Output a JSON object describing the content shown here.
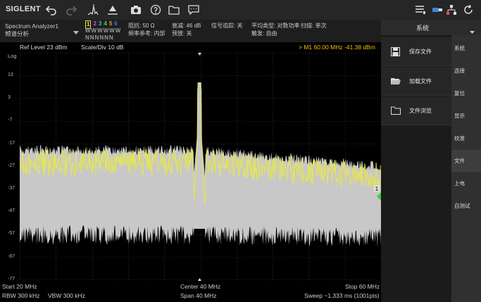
{
  "toolbar": {
    "logo": "SIGLENT"
  },
  "info": {
    "instrument": "Spectrum Analyzer1",
    "mode": "频谱分析",
    "trace_numbers": [
      "1",
      "2",
      "3",
      "4",
      "5",
      "6"
    ],
    "trace_modes": "WWWWWW",
    "trace_det": "NNNNNN",
    "impedance": "阻抗: 50 Ω",
    "freq_ref": "频率参考: 内部",
    "attenuation": "衰减: 46 dB",
    "preamp": "预放: 关",
    "tracking": "信号追踪: 关",
    "avg_type": "平均类型: 对数功率",
    "trigger": "触发: 自由",
    "sweep_mode": "扫描: 单次"
  },
  "plot": {
    "ref_level": "Ref Level  23 dBm",
    "scale_div": "Scale/Div  10 dB",
    "marker": "> M1   60.00 MHz  -41.38 dBm",
    "log_label": "Log",
    "marker_tag": "1",
    "y_ticks": [
      "13",
      "3",
      "-7",
      "-17",
      "-27",
      "-37",
      "-47",
      "-57",
      "-67",
      "-77"
    ]
  },
  "bottom": {
    "start": "Start  20 MHz",
    "center": "Center  40 MHz",
    "stop": "Stop  60 MHz",
    "rbw": "RBW  300 kHz",
    "vbw": "VBW  300 kHz",
    "span": "Span  40 MHz",
    "sweep": "Sweep  ~1.333 ms (1001pts)"
  },
  "right_panel": {
    "header": "系统",
    "file_items": [
      {
        "label": "保存文件",
        "icon": "save-icon"
      },
      {
        "label": "加载文件",
        "icon": "folder-open-icon"
      },
      {
        "label": "文件浏览",
        "icon": "folder-icon"
      }
    ],
    "categories": [
      "系统",
      "连接",
      "复位",
      "显示",
      "校准",
      "文件",
      "上电",
      "自测试"
    ],
    "active_category": "文件"
  },
  "colors": {
    "trace_yellow": "#e8e84a",
    "trace_gray": "#c8c8c8",
    "marker_green": "#3cd03c",
    "marker_text": "#f0c000"
  }
}
